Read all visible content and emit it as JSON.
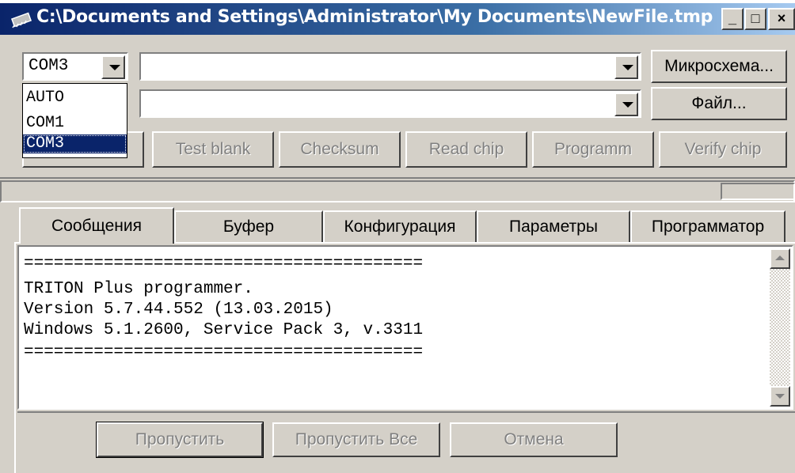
{
  "window": {
    "title": "C:\\Documents and Settings\\Administrator\\My Documents\\NewFile.tmp",
    "icon": "chip-icon",
    "controls": {
      "minimize": "_",
      "maximize": "□",
      "close": "×"
    }
  },
  "port": {
    "selected": "COM3",
    "options": [
      "AUTO",
      "COM1",
      "COM3"
    ],
    "highlighted": "COM3"
  },
  "chip_select": {
    "value": "",
    "button_label": "Микросхема..."
  },
  "file_select": {
    "value": "",
    "button_label": "Файл..."
  },
  "actions": {
    "test_blank": "Test blank",
    "checksum": "Checksum",
    "read_chip": "Read chip",
    "programm": "Programm",
    "verify_chip": "Verify chip"
  },
  "tabs": [
    "Сообщения",
    "Буфер",
    "Конфигурация",
    "Параметры",
    "Программатор"
  ],
  "active_tab": "Сообщения",
  "messages": [
    "========================================",
    "TRITON Plus programmer.",
    "Version 5.7.44.552 (13.03.2015)",
    "Windows 5.1.2600, Service Pack 3, v.3311",
    "========================================"
  ],
  "bottom": {
    "skip": "Пропустить",
    "skip_all": "Пропустить Все",
    "cancel": "Отмена"
  },
  "colors": {
    "titlebar": "#0a246a",
    "face": "#d4d0c8",
    "selection": "#0a246a"
  }
}
